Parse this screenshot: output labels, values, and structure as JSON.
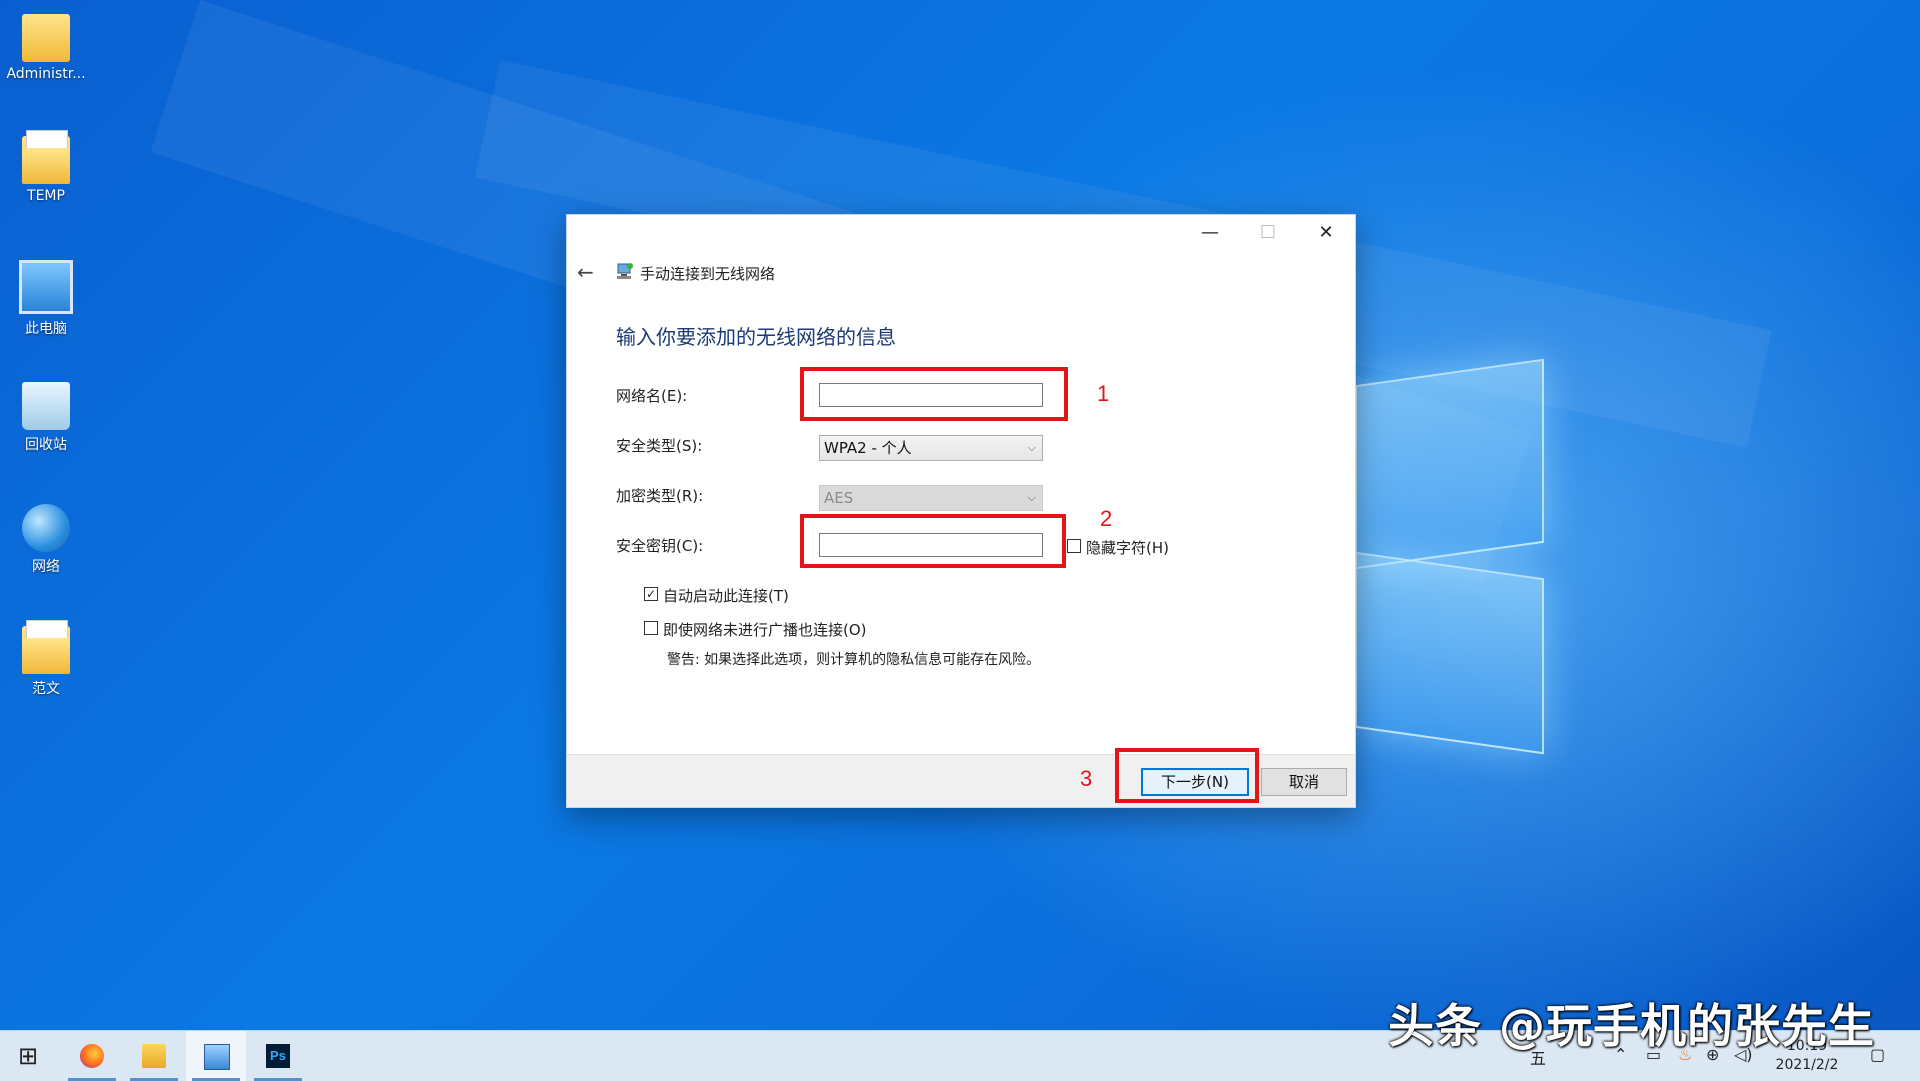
{
  "desktop": {
    "icons": [
      {
        "label": "Administr...",
        "icon": "user-folder-icon"
      },
      {
        "label": "TEMP",
        "icon": "folder-icon"
      },
      {
        "label": "此电脑",
        "icon": "computer-icon"
      },
      {
        "label": "回收站",
        "icon": "recycle-bin-icon"
      },
      {
        "label": "网络",
        "icon": "network-icon"
      },
      {
        "label": "范文",
        "icon": "folder-icon"
      }
    ]
  },
  "dialog": {
    "window_controls": {
      "minimize": "—",
      "maximize": "☐",
      "close": "✕"
    },
    "back": "←",
    "title": "手动连接到无线网络",
    "heading": "输入你要添加的无线网络的信息",
    "fields": {
      "network_name_label": "网络名(E):",
      "network_name_value": "",
      "security_type_label": "安全类型(S):",
      "security_type_value": "WPA2 - 个人",
      "encryption_label": "加密类型(R):",
      "encryption_value": "AES",
      "security_key_label": "安全密钥(C):",
      "security_key_value": "",
      "hide_chars_label": "隐藏字符(H)"
    },
    "options": {
      "auto_connect_label": "自动启动此连接(T)",
      "auto_connect_checked": true,
      "connect_hidden_label": "即使网络未进行广播也连接(O)",
      "connect_hidden_checked": false,
      "warning": "警告: 如果选择此选项，则计算机的隐私信息可能存在风险。"
    },
    "buttons": {
      "next": "下一步(N)",
      "cancel": "取消"
    }
  },
  "annotations": {
    "step1": "1",
    "step2": "2",
    "step3": "3",
    "color": "#e3151b"
  },
  "taskbar": {
    "start": "⊞",
    "ime": "五",
    "clock_time": "10:19",
    "clock_date": "2021/2/2"
  },
  "watermark": "头条 @玩手机的张先生"
}
